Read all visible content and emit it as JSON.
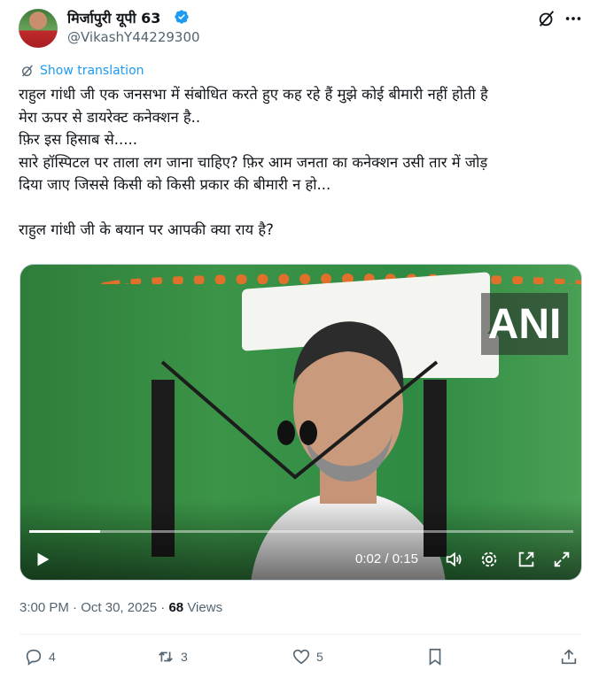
{
  "author": {
    "name": "मिर्जापुरी यूपी 63",
    "handle": "@VikashY44229300"
  },
  "translate": {
    "label": "Show translation"
  },
  "tweet": {
    "text": "राहुल गांधी जी एक जनसभा में संबोधित करते हुए कह रहे हैं मुझे कोई बीमारी नहीं होती है\nमेरा ऊपर से डायरेक्ट कनेक्शन है..\nफ़िर इस हिसाब से.....\nसारे हॉस्पिटल पर ताला लग जाना चाहिए? फ़िर आम जनता का कनेक्शन उसी तार में जोड़\nदिया जाए जिससे किसी को किसी प्रकार की बीमारी न हो...\n\nराहुल गांधी जी के बयान पर आपकी क्या राय है?"
  },
  "video": {
    "watermark": "ANI",
    "current_time": "0:02",
    "duration": "0:15",
    "progress": 0.13
  },
  "meta": {
    "time": "3:00 PM",
    "date": "Oct 30, 2025",
    "views_count": "68",
    "views_label": "Views"
  },
  "actions": {
    "replies": "4",
    "reposts": "3",
    "likes": "5"
  },
  "colors": {
    "accent": "#1d9bf0",
    "secondary_text": "#536471"
  }
}
